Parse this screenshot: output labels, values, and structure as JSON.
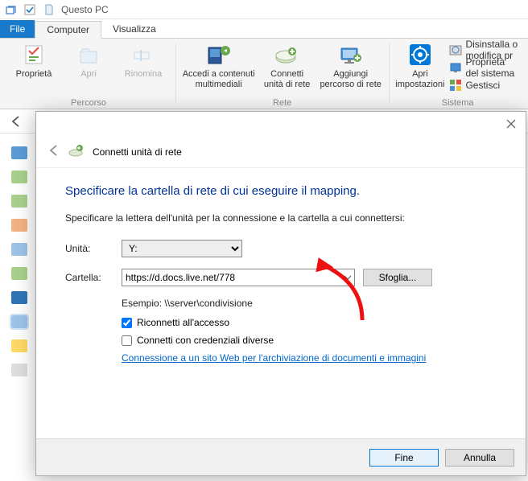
{
  "window": {
    "title": "Questo PC"
  },
  "tabs": {
    "file": "File",
    "computer": "Computer",
    "view": "Visualizza"
  },
  "ribbon": {
    "properties": "Proprietà",
    "open": "Apri",
    "rename": "Rinomina",
    "group_location": "Percorso",
    "media_access": "Accedi a contenuti\nmultimediali",
    "map_drive": "Connetti\nunità di rete",
    "add_netloc": "Aggiungi\npercorso di rete",
    "group_network": "Rete",
    "open_settings": "Apri\nimpostazioni",
    "uninstall": "Disinstalla o modifica pr",
    "sys_props": "Proprietà del sistema",
    "manage": "Gestisci",
    "group_system": "Sistema"
  },
  "dialog": {
    "title": "Connetti unità di rete",
    "heading": "Specificare la cartella di rete di cui eseguire il mapping.",
    "subheading": "Specificare la lettera dell'unità per la connessione e la cartella a cui connettersi:",
    "drive_label": "Unità:",
    "drive_value": "Y:",
    "folder_label": "Cartella:",
    "folder_value": "https://d.docs.live.net/778",
    "browse": "Sfoglia...",
    "example": "Esempio: \\\\server\\condivisione",
    "reconnect": "Riconnetti all'accesso",
    "diff_creds": "Connetti con credenziali diverse",
    "doc_link": "Connessione a un sito Web per l'archiviazione di documenti e immagini",
    "finish": "Fine",
    "cancel": "Annulla"
  }
}
